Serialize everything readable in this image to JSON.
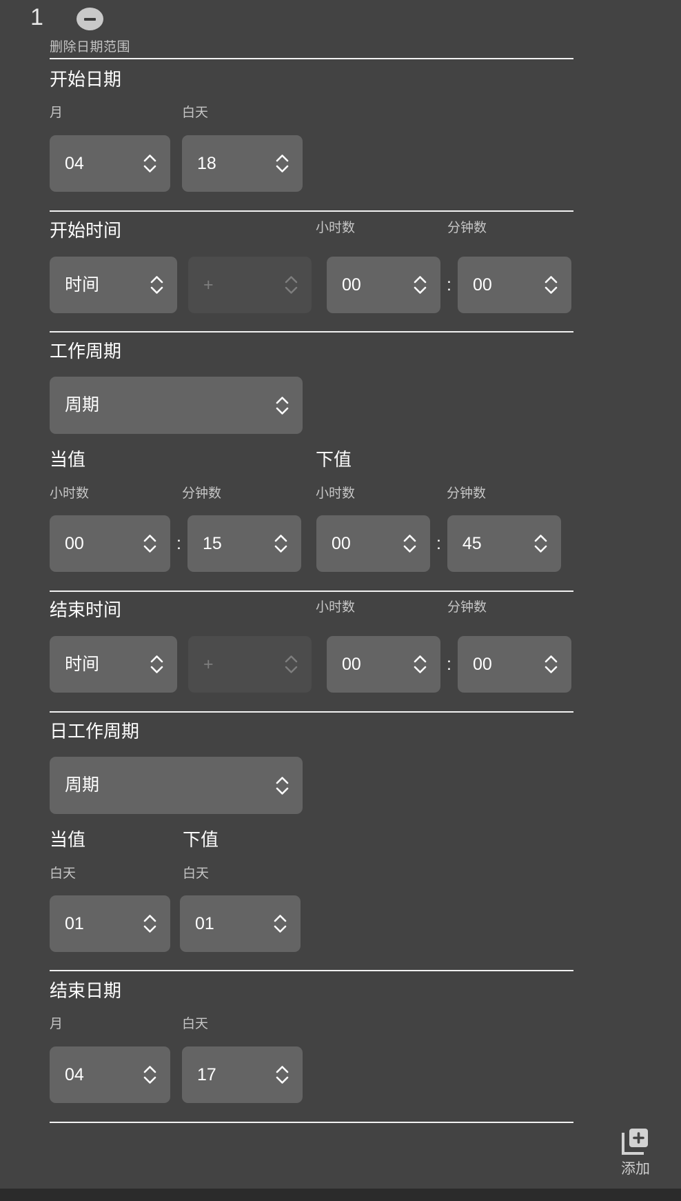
{
  "header": {
    "index": "1",
    "remove_icon": "minus-circle-icon",
    "remove_label": "删除日期范围"
  },
  "sections": {
    "start_date": {
      "title": "开始日期",
      "month_label": "月",
      "month_value": "04",
      "day_label": "白天",
      "day_value": "18"
    },
    "start_time": {
      "title": "开始时间",
      "mode_value": "时间",
      "plus_value": "+",
      "hour_label": "小时数",
      "hour_value": "00",
      "minute_label": "分钟数",
      "minute_value": "00",
      "separator": ":"
    },
    "work_cycle": {
      "title": "工作周期",
      "cycle_value": "周期",
      "on_label": "当值",
      "off_label": "下值",
      "on_hour_label": "小时数",
      "on_hour_value": "00",
      "on_minute_label": "分钟数",
      "on_minute_value": "15",
      "off_hour_label": "小时数",
      "off_hour_value": "00",
      "off_minute_label": "分钟数",
      "off_minute_value": "45",
      "separator": ":"
    },
    "end_time": {
      "title": "结束时间",
      "mode_value": "时间",
      "plus_value": "+",
      "hour_label": "小时数",
      "hour_value": "00",
      "minute_label": "分钟数",
      "minute_value": "00",
      "separator": ":"
    },
    "day_work_cycle": {
      "title": "日工作周期",
      "cycle_value": "周期",
      "on_label": "当值",
      "off_label": "下值",
      "on_day_label": "白天",
      "on_day_value": "01",
      "off_day_label": "白天",
      "off_day_value": "01"
    },
    "end_date": {
      "title": "结束日期",
      "month_label": "月",
      "month_value": "04",
      "day_label": "白天",
      "day_value": "17"
    }
  },
  "add_button": {
    "icon": "library-add-icon",
    "label": "添加"
  },
  "colors": {
    "background": "#434343",
    "field": "#646464",
    "field_disabled": "#4c4c4c",
    "rule": "#f2f2f2",
    "text": "#ffffff",
    "text_muted": "#c6c6c6"
  }
}
